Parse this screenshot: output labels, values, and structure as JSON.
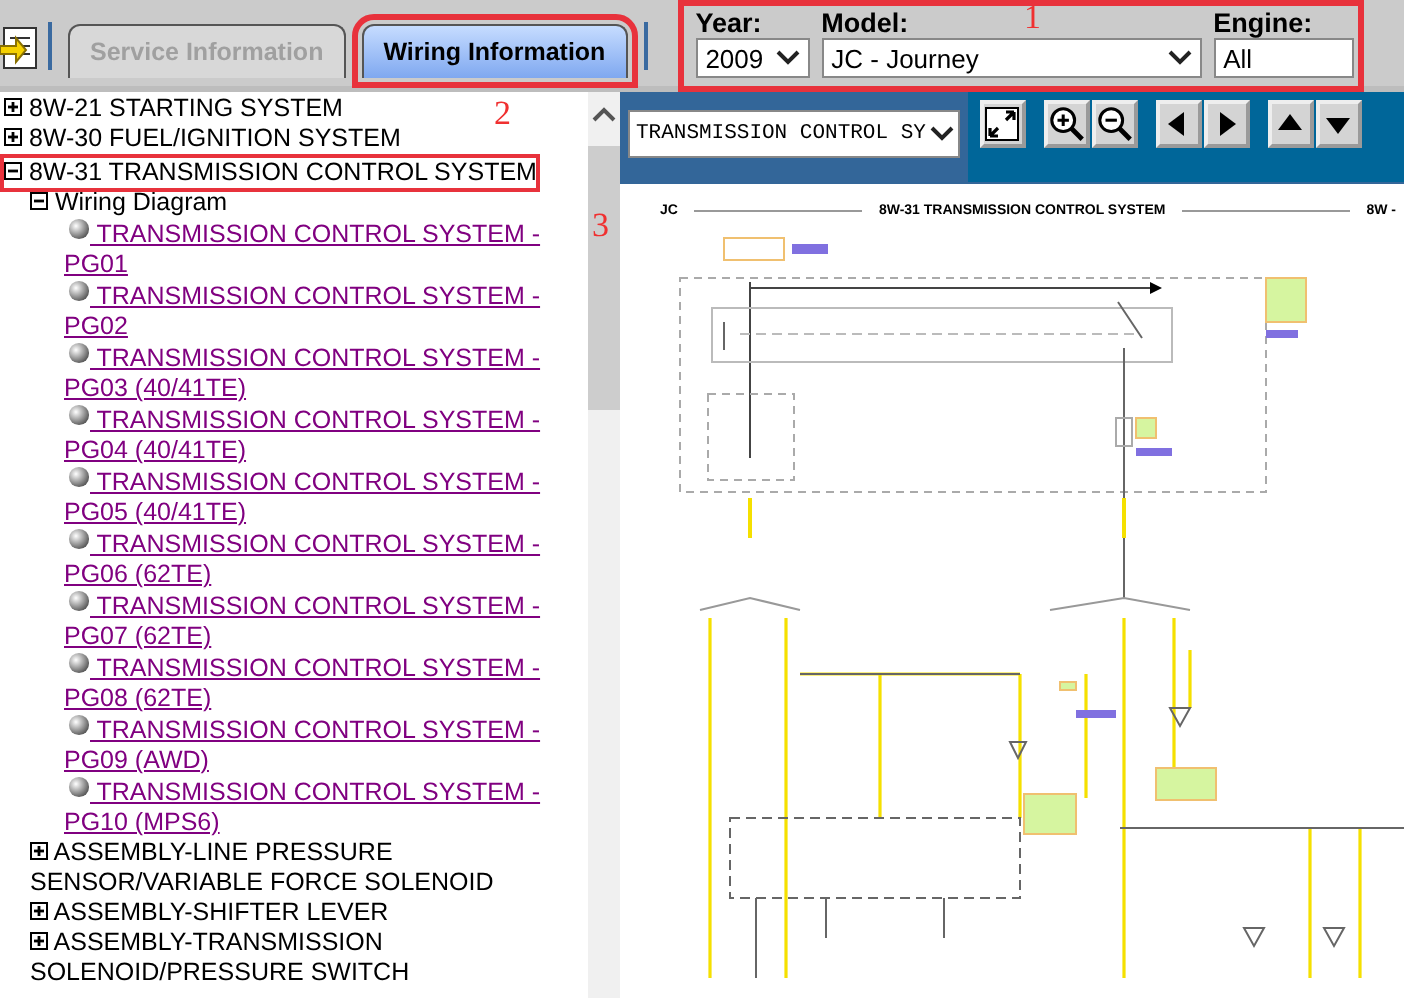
{
  "header": {
    "tabs": [
      {
        "label": "Service Information",
        "selected": false,
        "disabled": true,
        "highlighted": false
      },
      {
        "label": "Wiring Information",
        "selected": true,
        "disabled": false,
        "highlighted": true
      }
    ],
    "filters": {
      "highlighted": true,
      "items": [
        {
          "kind": "select",
          "label": "Year:",
          "value": "2009"
        },
        {
          "kind": "select",
          "label": "Model:",
          "value": "JC - Journey"
        },
        {
          "kind": "field",
          "label": "Engine:",
          "value": "All"
        }
      ]
    }
  },
  "tree": {
    "items": [
      {
        "kind": "folder",
        "label": "8W-21 STARTING SYSTEM",
        "expanded": false,
        "highlighted": false
      },
      {
        "kind": "folder",
        "label": "8W-30 FUEL/IGNITION SYSTEM",
        "expanded": false,
        "highlighted": false
      },
      {
        "kind": "folder",
        "label": "8W-31 TRANSMISSION CONTROL SYSTEM",
        "expanded": true,
        "highlighted": true,
        "children": [
          {
            "kind": "folder",
            "label": "Wiring Diagram",
            "expanded": true,
            "highlighted": false,
            "children": [
              {
                "kind": "link",
                "label": "TRANSMISSION CONTROL SYSTEM - PG01"
              },
              {
                "kind": "link",
                "label": "TRANSMISSION CONTROL SYSTEM - PG02"
              },
              {
                "kind": "link",
                "label": "TRANSMISSION CONTROL SYSTEM - PG03 (40/41TE)"
              },
              {
                "kind": "link",
                "label": "TRANSMISSION CONTROL SYSTEM - PG04 (40/41TE)"
              },
              {
                "kind": "link",
                "label": "TRANSMISSION CONTROL SYSTEM - PG05 (40/41TE)"
              },
              {
                "kind": "link",
                "label": "TRANSMISSION CONTROL SYSTEM - PG06 (62TE)"
              },
              {
                "kind": "link",
                "label": "TRANSMISSION CONTROL SYSTEM - PG07 (62TE)"
              },
              {
                "kind": "link",
                "label": "TRANSMISSION CONTROL SYSTEM - PG08 (62TE)"
              },
              {
                "kind": "link",
                "label": "TRANSMISSION CONTROL SYSTEM - PG09 (AWD)"
              },
              {
                "kind": "link",
                "label": "TRANSMISSION CONTROL SYSTEM - PG10 (MPS6)"
              }
            ]
          },
          {
            "kind": "folder",
            "label": "ASSEMBLY-LINE PRESSURE SENSOR/VARIABLE FORCE SOLENOID",
            "expanded": false,
            "highlighted": false
          },
          {
            "kind": "folder",
            "label": "ASSEMBLY-SHIFTER LEVER",
            "expanded": false,
            "highlighted": false
          },
          {
            "kind": "folder",
            "label": "ASSEMBLY-TRANSMISSION SOLENOID/PRESSURE SWITCH",
            "expanded": false,
            "highlighted": false
          }
        ]
      }
    ]
  },
  "viewer": {
    "page_select": {
      "value": "TRANSMISSION CONTROL SY"
    },
    "diagram": {
      "left_header": "JC",
      "title": "8W-31 TRANSMISSION CONTROL SYSTEM",
      "right_header": "8W -"
    }
  },
  "annotations": [
    {
      "label": "1"
    },
    {
      "label": "2"
    },
    {
      "label": "3"
    }
  ]
}
